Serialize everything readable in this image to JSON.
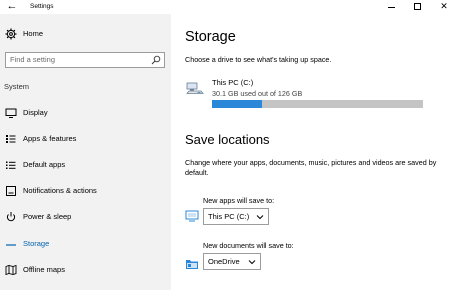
{
  "window": {
    "title": "Settings",
    "back_glyph": "←",
    "close_glyph": "✕"
  },
  "sidebar": {
    "home_label": "Home",
    "search_placeholder": "Find a setting",
    "section_label": "System",
    "items": [
      {
        "label": "Display",
        "icon": "display-icon"
      },
      {
        "label": "Apps & features",
        "icon": "apps-list-icon"
      },
      {
        "label": "Default apps",
        "icon": "default-apps-icon"
      },
      {
        "label": "Notifications & actions",
        "icon": "notifications-icon"
      },
      {
        "label": "Power & sleep",
        "icon": "power-icon"
      },
      {
        "label": "Storage",
        "icon": "storage-icon",
        "active": true
      },
      {
        "label": "Offline maps",
        "icon": "map-icon"
      }
    ]
  },
  "main": {
    "title": "Storage",
    "description": "Choose a drive to see what's taking up space.",
    "drive": {
      "name": "This PC (C:)",
      "usage_text": "30.1 GB used out of 126 GB",
      "used_fraction": 0.239
    },
    "save_locations": {
      "title": "Save locations",
      "description": "Change where your apps, documents, music, pictures and videos are saved by default.",
      "new_apps_label": "New apps will save to:",
      "new_apps_value": "This PC (C:)",
      "new_docs_label": "New documents will save to:",
      "new_docs_value": "OneDrive"
    }
  },
  "colors": {
    "accent": "#0063b1",
    "progress_fill": "#2b88d8",
    "progress_track": "#c4c4c4",
    "sidebar_bg": "#f2f2f2"
  }
}
